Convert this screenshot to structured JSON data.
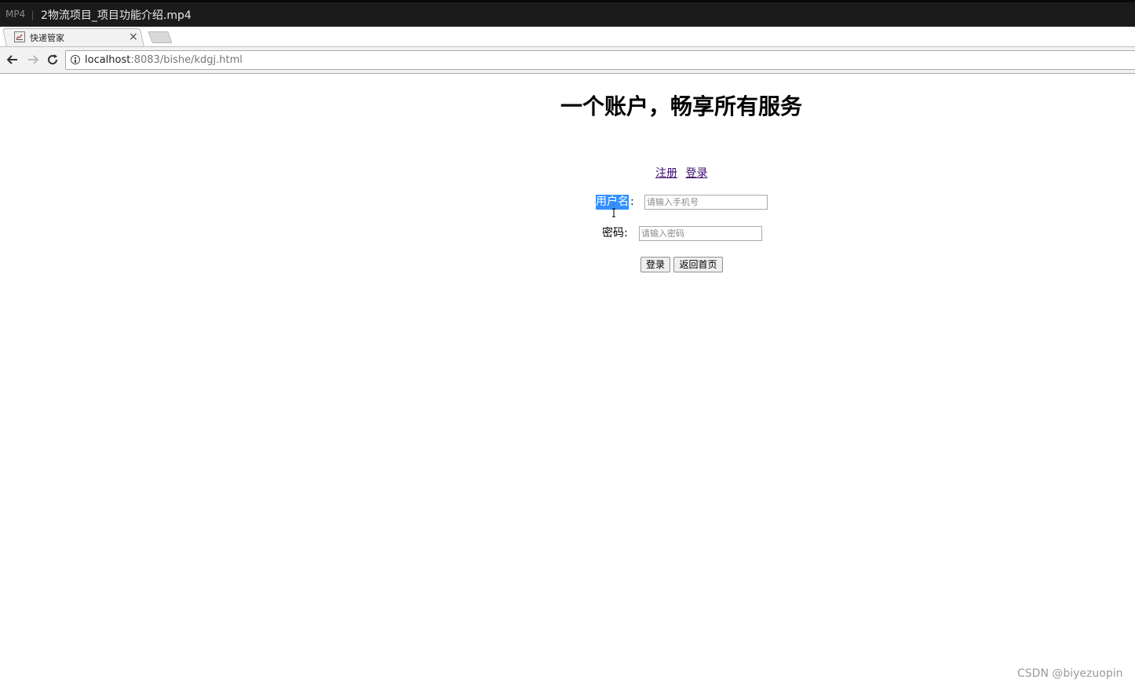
{
  "player": {
    "badge": "MP4",
    "title": "2物流项目_项目功能介绍.mp4"
  },
  "browser": {
    "tab_title": "快递管家",
    "tab_close": "×",
    "url_host": "localhost",
    "url_rest": ":8083/bishe/kdgj.html",
    "icons": [
      "back-arrow-icon",
      "forward-arrow-icon",
      "reload-icon",
      "info-icon",
      "close-icon"
    ]
  },
  "page": {
    "heading": "一个账户，畅享所有服务",
    "links": {
      "register": "注册",
      "login": "登录"
    },
    "username_label": "用户名",
    "username_colon": ":",
    "username_placeholder": "请输入手机号",
    "password_label": "密码:",
    "password_placeholder": "请输入密码",
    "login_button": "登录",
    "home_button": "返回首页"
  },
  "watermark": "CSDN @biyezuopin",
  "colors": {
    "selection": "#3390ff",
    "link": "#3b0b6b",
    "player_bar": "#1b1b1b"
  }
}
